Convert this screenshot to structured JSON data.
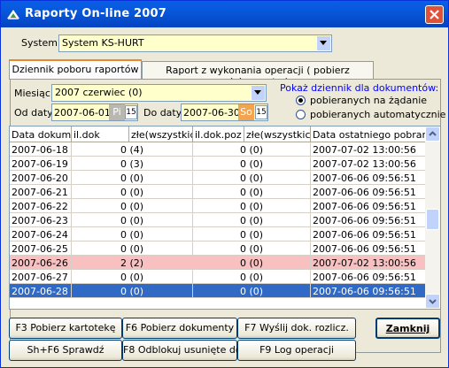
{
  "window": {
    "title": "Raporty On-line 2007"
  },
  "system": {
    "label": "System:",
    "value": "System KS-HURT"
  },
  "tabs": [
    {
      "label": "Dziennik poboru raportów",
      "active": true
    },
    {
      "label": "Raport z wykonania operacji ( pobierz dokumenty )",
      "active": false
    }
  ],
  "filters": {
    "month_label": "Miesiąc:",
    "month_value": "2007 czerwiec  (0)",
    "from_label": "Od daty:",
    "from_value": "2007-06-01",
    "from_day": "Pi",
    "to_label": "Do daty:",
    "to_value": "2007-06-30",
    "to_day": "So",
    "cal_glyph": "15"
  },
  "show_log": {
    "title": "Pokaż dziennik dla dokumentów:",
    "options": [
      {
        "label": "pobieranych na żądanie",
        "selected": true
      },
      {
        "label": "pobieranych automatycznie",
        "selected": false
      }
    ]
  },
  "table": {
    "columns": [
      "Data dokumentów",
      "il.dok",
      "złe(wszystkich)",
      "il.dok.poz",
      "złe(wszystkich)",
      "Data ostatniego pobrania"
    ],
    "rows": [
      {
        "date": "2007-06-18",
        "count": "0 (4)",
        "poz": "0 (0)",
        "last": "2007-07-02 13:00:56",
        "state": "normal"
      },
      {
        "date": "2007-06-19",
        "count": "0 (3)",
        "poz": "0 (0)",
        "last": "2007-07-02 13:00:56",
        "state": "normal"
      },
      {
        "date": "2007-06-20",
        "count": "0 (0)",
        "poz": "0 (0)",
        "last": "2007-06-06 09:56:51",
        "state": "normal"
      },
      {
        "date": "2007-06-21",
        "count": "0 (0)",
        "poz": "0 (0)",
        "last": "2007-06-06 09:56:51",
        "state": "normal"
      },
      {
        "date": "2007-06-22",
        "count": "0 (0)",
        "poz": "0 (0)",
        "last": "2007-06-06 09:56:51",
        "state": "normal"
      },
      {
        "date": "2007-06-23",
        "count": "0 (0)",
        "poz": "0 (0)",
        "last": "2007-06-06 09:56:51",
        "state": "normal"
      },
      {
        "date": "2007-06-24",
        "count": "0 (0)",
        "poz": "0 (0)",
        "last": "2007-06-06 09:56:51",
        "state": "normal"
      },
      {
        "date": "2007-06-25",
        "count": "0 (0)",
        "poz": "0 (0)",
        "last": "2007-06-06 09:56:51",
        "state": "normal"
      },
      {
        "date": "2007-06-26",
        "count": "2 (2)",
        "poz": "0 (0)",
        "last": "2007-07-02 13:00:56",
        "state": "error"
      },
      {
        "date": "2007-06-27",
        "count": "0 (0)",
        "poz": "0 (0)",
        "last": "2007-06-06 09:56:51",
        "state": "normal"
      },
      {
        "date": "2007-06-28",
        "count": "0 (0)",
        "poz": "0 (0)",
        "last": "2007-06-06 09:56:51",
        "state": "selected"
      }
    ]
  },
  "buttons": {
    "f3": "F3 Pobierz kartotekę",
    "f6": "F6 Pobierz dokumenty",
    "f7": "F7 Wyślij dok. rozlicz.",
    "sf6": "Sh+F6 Sprawdź",
    "f8": "F8 Odblokuj usunięte dok.",
    "f9": "F9 Log operacji",
    "close": "Zamknij"
  },
  "colors": {
    "titlebar": "#0756d8",
    "field_bg": "#ffffcc",
    "error_row": "#f8c0c0",
    "selected_row": "#316ac5",
    "legend_blue": "#0000ff"
  }
}
